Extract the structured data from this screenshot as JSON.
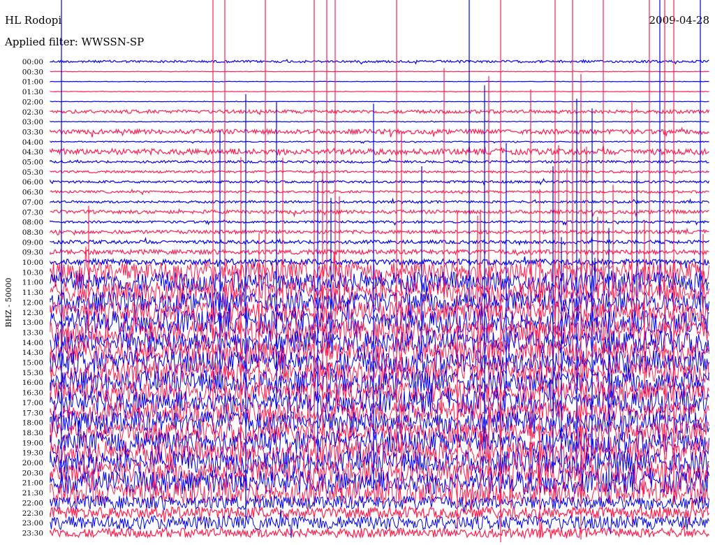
{
  "header": {
    "station": "HL Rodopi",
    "date": "2009-04-28",
    "filter": "Applied filter: WWSSN-SP",
    "channel": "BHZ - 50000"
  },
  "colors": {
    "trace_a": "#0000ee",
    "trace_b": "#ff1f4f",
    "background": "#ffffff",
    "text": "#000000"
  },
  "chart_data": {
    "type": "line",
    "title": "HL Rodopi",
    "ylabel": "BHZ - 50000",
    "categories": [
      "00:00",
      "00:30",
      "01:00",
      "01:30",
      "02:00",
      "02:30",
      "03:00",
      "03:30",
      "04:00",
      "04:30",
      "05:00",
      "05:30",
      "06:00",
      "06:30",
      "07:00",
      "07:30",
      "08:00",
      "08:30",
      "09:00",
      "09:30",
      "10:00",
      "10:30",
      "11:00",
      "11:30",
      "12:00",
      "12:30",
      "13:00",
      "13:30",
      "14:00",
      "14:30",
      "15:00",
      "15:30",
      "16:00",
      "16:30",
      "17:00",
      "17:30",
      "18:00",
      "18:30",
      "19:00",
      "19:30",
      "20:00",
      "20:30",
      "21:00",
      "21:30",
      "22:00",
      "22:30",
      "23:00",
      "23:30"
    ],
    "series": [
      {
        "values": [
          0.1,
          0.02,
          0.02,
          0.02,
          0.02,
          0.15,
          0.03,
          0.2,
          0.05,
          0.25,
          0.1,
          0.1,
          0.1,
          0.1,
          0.1,
          0.15,
          0.1,
          0.15,
          0.15,
          0.2,
          0.25,
          0.9,
          0.9,
          0.9,
          0.9,
          0.9,
          1.0,
          1.0,
          1.0,
          1.0,
          1.0,
          0.9,
          1.0,
          0.9,
          1.0,
          0.9,
          1.0,
          0.9,
          1.0,
          1.0,
          1.0,
          1.0,
          1.0,
          1.0,
          0.6,
          0.5,
          0.6,
          0.4
        ]
      }
    ],
    "grid": false
  }
}
